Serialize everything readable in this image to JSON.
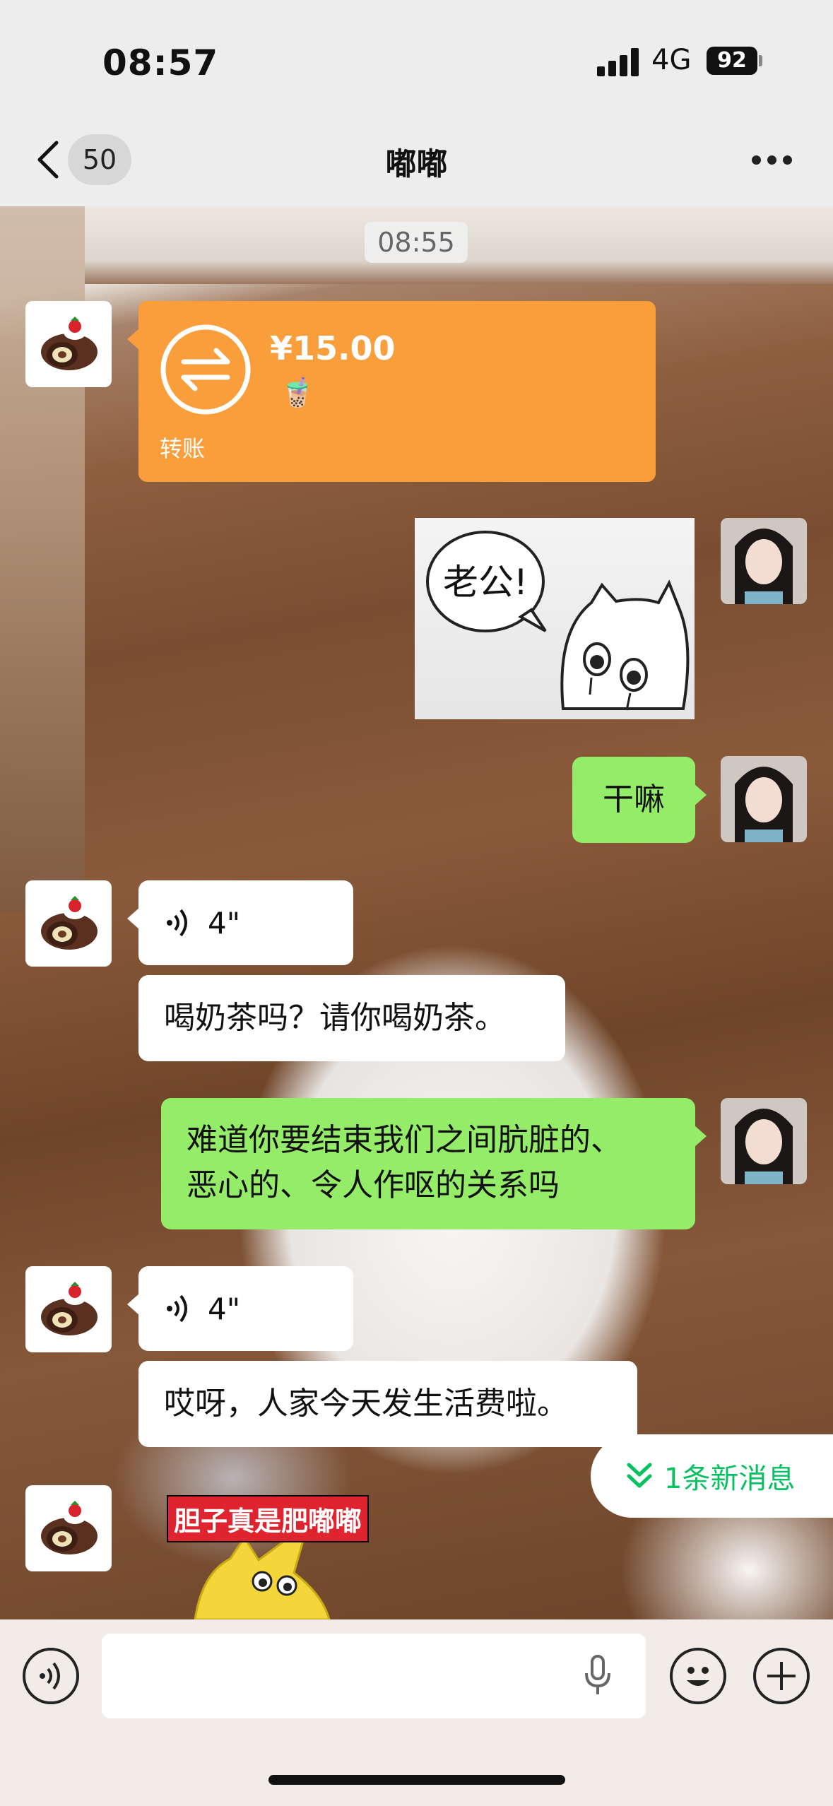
{
  "status_bar": {
    "time": "08:57",
    "network": "4G",
    "battery": "92"
  },
  "nav": {
    "unread_count": "50",
    "title": "嘟嘟"
  },
  "chat": {
    "timestamp": "08:55",
    "transfer": {
      "amount": "¥15.00",
      "note_emoji": "🧋",
      "label": "转账"
    },
    "sticker1_text": "老公!",
    "msg_ganma": "干嘛",
    "voice1_duration": "4\"",
    "msg_milk_tea": "喝奶茶吗？请你喝奶茶。",
    "msg_long_line1": "难道你要结束我们之间肮脏的、",
    "msg_long_line2": "恶心的、令人作呕的关系吗",
    "voice2_duration": "4\"",
    "msg_allowance": "哎呀，人家今天发生活费啦。",
    "new_message_pill": "1条新消息",
    "sticker2_caption": "胆子真是肥嘟嘟"
  },
  "colors": {
    "green_bubble": "#95ec69",
    "transfer_orange": "#fa9d3b",
    "accent_green": "#07c160"
  }
}
